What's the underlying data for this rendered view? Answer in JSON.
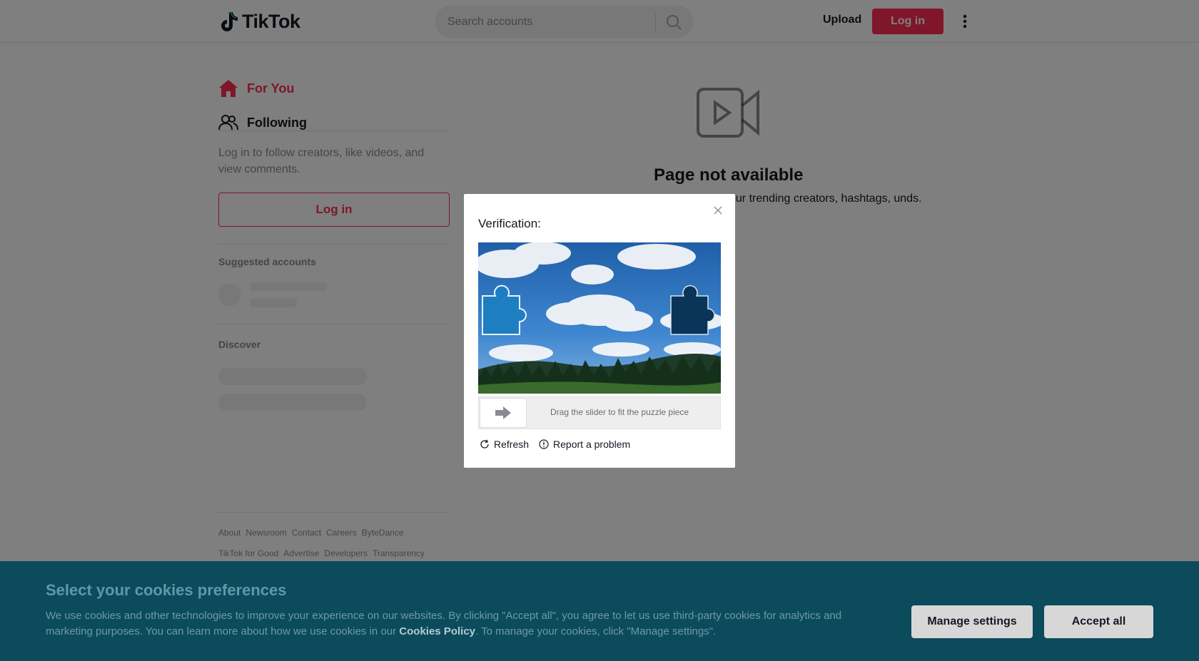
{
  "header": {
    "logo_text": "TikTok",
    "search_placeholder": "Search accounts",
    "upload_label": "Upload",
    "login_label": "Log in"
  },
  "sidebar": {
    "nav": [
      {
        "label": "For You",
        "icon": "home-icon",
        "active": true
      },
      {
        "label": "Following",
        "icon": "users-icon",
        "active": false
      }
    ],
    "login_hint": "Log in to follow creators, like videos, and view comments.",
    "login_button": "Log in",
    "suggested_title": "Suggested accounts",
    "discover_title": "Discover",
    "footer_links_row1": [
      "About",
      "Newsroom",
      "Contact",
      "Careers",
      "ByteDance"
    ],
    "footer_links_row2": [
      "TikTok for Good",
      "Advertise",
      "Developers",
      "Transparency"
    ]
  },
  "main": {
    "title": "Page not available",
    "description": "our trending creators, hashtags, unds."
  },
  "captcha": {
    "title": "Verification:",
    "slider_hint": "Drag the slider to fit the puzzle piece",
    "refresh_label": "Refresh",
    "report_label": "Report a problem"
  },
  "cookie_banner": {
    "title": "Select your cookies preferences",
    "text_before_link": "We use cookies and other technologies to improve your experience on our websites. By clicking \"Accept all\", you agree to let us use third-party cookies for analytics and marketing purposes. You can learn more about how we use cookies in our ",
    "link_text": "Cookies Policy",
    "text_after_link": ". To manage your cookies, click \"Manage settings\".",
    "manage_button": "Manage settings",
    "accept_button": "Accept all"
  },
  "colors": {
    "brand": "#fe2c55",
    "cookie_bg": "#0b4b5c"
  }
}
